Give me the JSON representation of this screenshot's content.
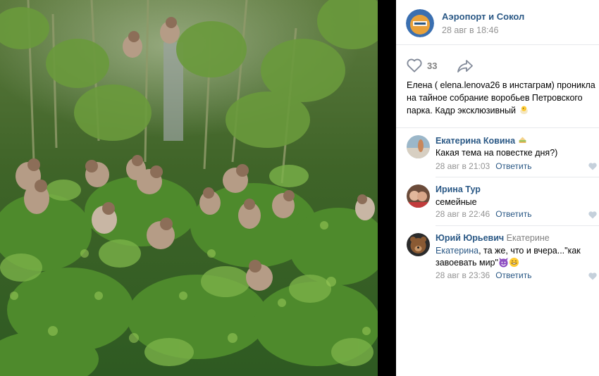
{
  "post": {
    "group_name": "Аэропорт и Сокол",
    "date": "28 авг в 18:46",
    "likes": "33",
    "text_lines": [
      "Елена ( elena.lenova26 в инстаграм) проникла",
      "на тайное собрание воробьев Петровского",
      "парка. Кадр эксклюзивный"
    ]
  },
  "comments": [
    {
      "author": "Екатерина Ковина",
      "reply_to": "",
      "text_lines": [
        "Какая тема на повестке дня?)"
      ],
      "date": "28 авг в 21:03",
      "reply_label": "Ответить"
    },
    {
      "author": "Ирина Тур",
      "reply_to": "",
      "text_lines": [
        "семейные"
      ],
      "date": "28 авг в 22:46",
      "reply_label": "Ответить"
    },
    {
      "author": "Юрий Юрьевич",
      "reply_to": "Екатерине",
      "mention": "Екатерина",
      "text_lines": [
        ", та же, что и вчера...\"как",
        "завоевать мир\""
      ],
      "date": "28 авг в 23:36",
      "reply_label": "Ответить"
    }
  ],
  "colors": {
    "link": "#2a5885",
    "meta": "#939393",
    "divider": "#e7e8ec",
    "panel": "#ffffff",
    "backdrop": "#000000"
  },
  "icons": {
    "like": "heart-outline-icon",
    "share": "share-arrow-icon",
    "comment_like": "heart-small-icon"
  }
}
